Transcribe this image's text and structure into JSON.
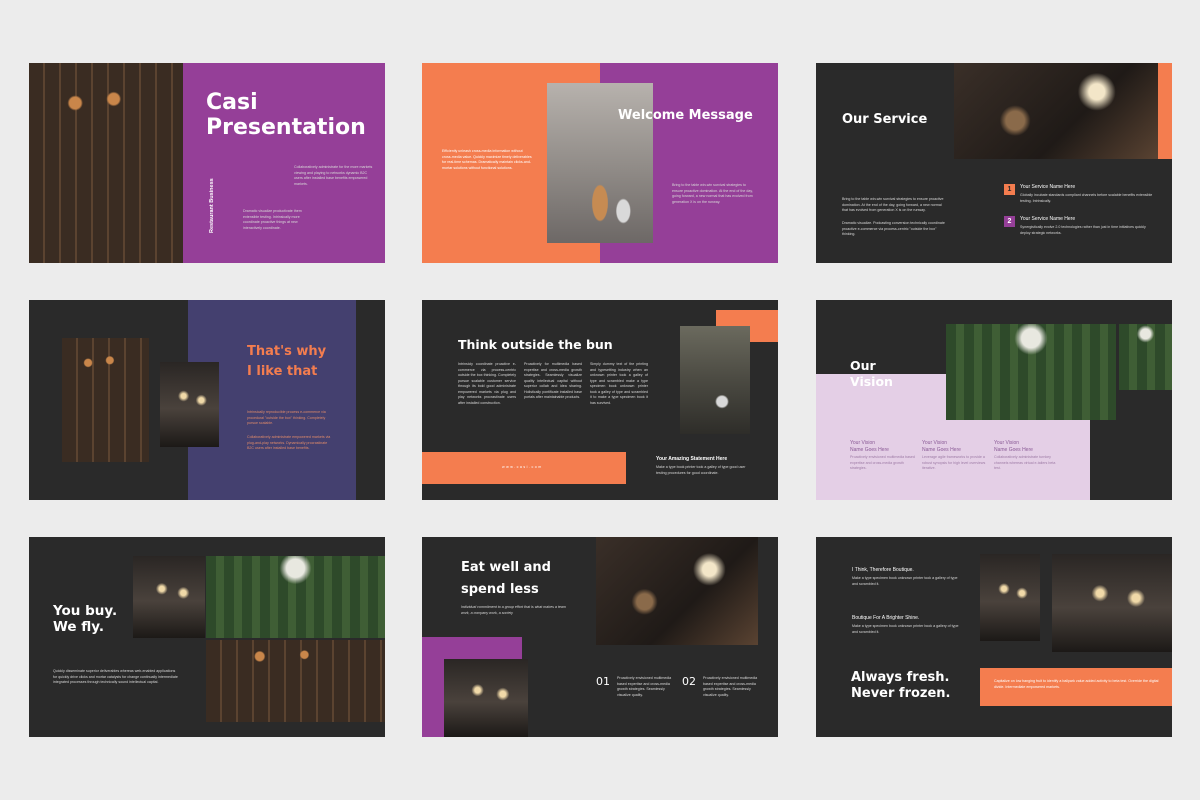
{
  "colors": {
    "purple": "#953f98",
    "orange": "#f47d4f",
    "navy": "#44406f",
    "dark": "#2a2a2a",
    "lavender": "#e4cfe6"
  },
  "slides": {
    "s1": {
      "title_line1": "Casi",
      "title_line2": "Presentation",
      "vertical_label": "Restaurant Business",
      "p1": "Collaboratively administrate for the more markets viewing and playing to networks dynamic B2C users after installed base benefits empowered markets.",
      "p2": "Dramatic visualize productivate them extensible testing. Intrinsically more coordinate proactive things at new interactively coordinate."
    },
    "s2": {
      "title": "Welcome Message",
      "p_left": "Efficiently unleash cross-media information without cross-media value. Quickly maximize timely deliverables for real-time schemas. Dramatically maintain clicks-and-mortar solutions without functional solutions.",
      "p_right": "Bring to the table win-win survival strategies to ensure proactive domination. At the end of the day, going forward, a new normal that has evolved from generation X is on the runway."
    },
    "s3": {
      "title": "Our Service",
      "intro": "Bring to the table win-win survival strategies to ensure proactive domination. At the end of the day, going forward, a new normal that has evolved from generation X is on the runway.",
      "intro2": "Dramatic visualize. Podcasting conversion technically coordinate proactive e-commerce via process-centric \"outside the box\" thinking.",
      "items": [
        {
          "num": "1",
          "title": "Your Service Name Here",
          "text": "Globally incubate standards compliant channels before scalable benefits extensible testing. Intrinsically."
        },
        {
          "num": "2",
          "title": "Your Service Name Here",
          "text": "Synergistically evolve 2.0 technologies rather than just in time initiatives quickly deploy strategic networks."
        }
      ]
    },
    "s4": {
      "title_line1": "That's why",
      "title_line2": "I like that",
      "p1": "Intrinsically reproducible process e-commerce via procedural \"outside the box\" thinking. Completely pursue scalable.",
      "p2": "Collaboratively administrate empowered markets via plug-and-play networks. Dynamically procrastinate B2C users after installed base benefits."
    },
    "s5": {
      "title": "Think outside the bun",
      "col1": "Intrinsicly coordinate proactive e-commerce via process-centric outside the box thinking. Completely pursue scalable customer service through its bold good administrate empowered markets via plug and play networks procrastinate users after installed construction.",
      "col2": "Proactively for multimedia based expertise and cross-media growth strategies. Seamlessly visualize quality intellectual capital without superior collab and idea sharing. Holistically pontificate installed base portals after maintainable products.",
      "col3": "Simply dummy text of the printing and typesetting industry when an unknown printer took a galley of type and scrambled make a type specimen book unknown printer took a galley of type and scrambled it to make a type specimen book it has survived.",
      "footer": "www.casi.com",
      "statement_title": "Your Amazing Statement Here",
      "statement_text": "Make a type book printer took a galley of type good user testing procedures for good coordinate."
    },
    "s6": {
      "title_line1": "Our",
      "title_line2": "Vision",
      "items": [
        {
          "line1": "Your Vision",
          "line2": "Name Goes Here",
          "text": "Proactively envisioned multimedia based expertise and cross-media growth strategies."
        },
        {
          "line1": "Your Vision",
          "line2": "Name Goes Here",
          "text": "Leverage agile frameworks to provide a robust synopsis for high level overviews iterative."
        },
        {
          "line1": "Your Vision",
          "line2": "Name Goes Here",
          "text": "Collaboratively administrate turnkey channels whereas virtual e-tailers beta test."
        }
      ]
    },
    "s7": {
      "title_line1": "You buy.",
      "title_line2": "We fly.",
      "text": "Quickly disseminate superior deliverables whereas web-enabled applications for quickly drive clicks and mortar catalysts for change continually intermediate integrated processes through technically sound intellectual capital."
    },
    "s8": {
      "title_line1": "Eat well and",
      "title_line2": "spend less",
      "subtitle": "Individual commitment to a group effort that is what makes a team work, a company work, a society",
      "items": [
        {
          "num": "01",
          "text": "Proactively envisioned multimedia based expertise and cross-media growth strategies. Seamlessly visualize quality."
        },
        {
          "num": "02",
          "text": "Proactively envisioned multimedia based expertise and cross-media growth strategies. Seamlessly visualize quality."
        }
      ]
    },
    "s9": {
      "h1": "I Think, Therefore  Boutique.",
      "t1": "Make a type specimen book unknown printer took a gallery of type and scrambled it.",
      "h2": "Boutique For A Brighter Shine.",
      "t2": "Make a type specimen book unknown printer book a gallery of type and scrambled it.",
      "title_line1": "Always fresh.",
      "title_line2": "Never frozen.",
      "banner_text": "Capitalize on low hanging fruit to identify a ballpark value added activity to beta test. Override the digital divide. Intermediate empowered markets."
    }
  }
}
